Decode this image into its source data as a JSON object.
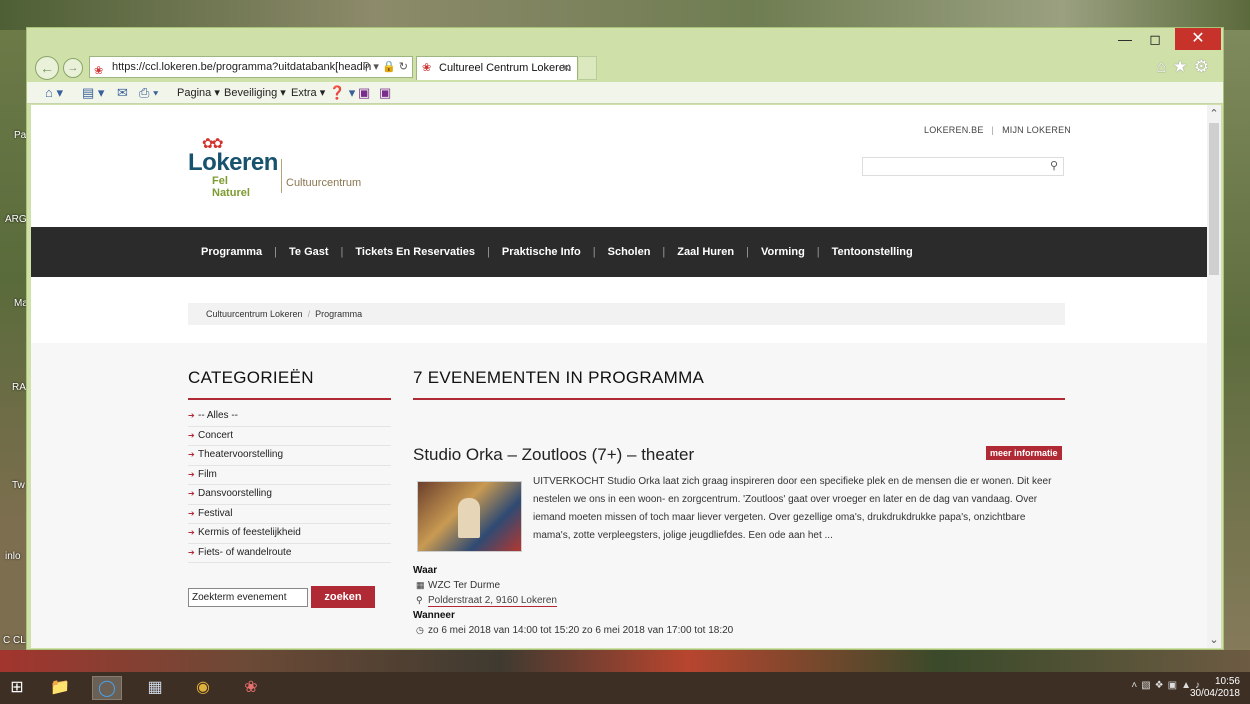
{
  "desktop": {
    "labels": [
      "Pa",
      "ARG",
      "Ma",
      "RA",
      "Tw",
      "inlo",
      "C CL"
    ]
  },
  "browser": {
    "address_url": "https://ccl.lokeren.be/programma?uitdatabank[headin",
    "tab_title": "Cultureel Centrum Lokeren",
    "commands": {
      "pagina": "Pagina",
      "beveiliging": "Beveiliging",
      "extra": "Extra"
    }
  },
  "site": {
    "toplinks": [
      "LOKEREN.BE",
      "MIJN LOKEREN"
    ],
    "logo": {
      "main": "Lokeren",
      "sub": "Fel Naturel",
      "section": "Cultuurcentrum"
    },
    "nav": [
      "Programma",
      "Te Gast",
      "Tickets En Reservaties",
      "Praktische Info",
      "Scholen",
      "Zaal Huren",
      "Vorming",
      "Tentoonstelling"
    ],
    "breadcrumb": [
      "Cultuurcentrum Lokeren",
      "Programma"
    ],
    "categories_title": "CATEGORIEËN",
    "categories": [
      "-- Alles --",
      "Concert",
      "Theatervoorstelling",
      "Film",
      "Dansvoorstelling",
      "Festival",
      "Kermis of feestelijkheid",
      "Fiets- of wandelroute"
    ],
    "search": {
      "value": "Zoekterm evenement",
      "button": "zoeken"
    },
    "events_title": "7 EVENEMENTEN IN PROGRAMMA",
    "event": {
      "title": "Studio Orka – Zoutloos (7+) – theater",
      "more": "meer informatie",
      "description": "UITVERKOCHT Studio Orka laat zich graag inspireren door een specifieke plek en de mensen die er wonen. Dit keer nestelen we ons in een woon- en zorgcentrum. 'Zoutloos' gaat over vroeger en later en de dag van vandaag. Over iemand moeten missen of toch maar liever vergeten. Over gezellige oma's, drukdrukdrukke papa's, onzichtbare mama's, zotte verpleegsters, jolige jeugdliefdes. Een ode aan het ...",
      "where_label": "Waar",
      "venue": "WZC Ter Durme",
      "address": "Polderstraat 2, 9160 Lokeren",
      "when_label": "Wanneer",
      "when": "zo 6 mei 2018 van 14:00 tot 15:20 zo 6 mei 2018 van 17:00 tot 18:20"
    },
    "colors": {
      "accent": "#b02a35",
      "nav_bg": "#2b2b2b"
    }
  },
  "taskbar": {
    "time": "10:56",
    "date": "30/04/2018"
  }
}
